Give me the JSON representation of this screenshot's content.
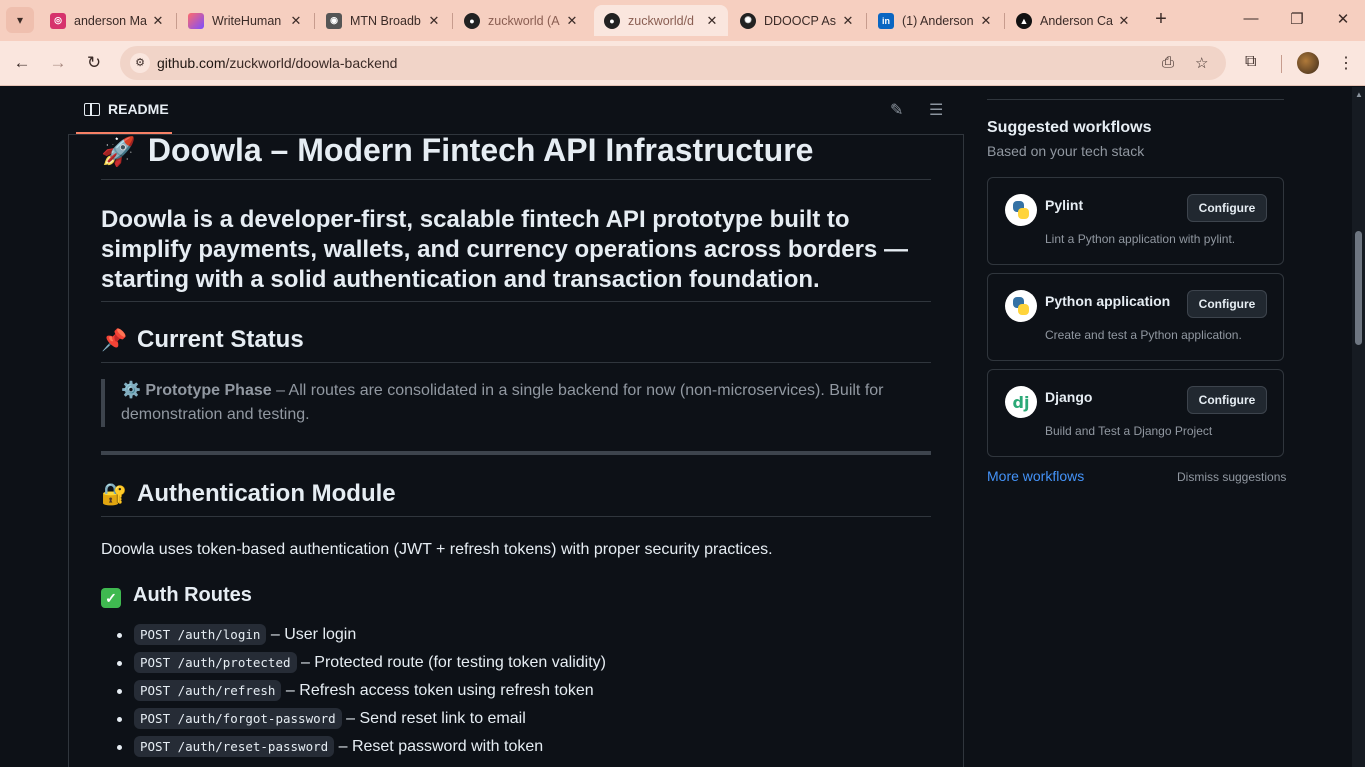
{
  "browser": {
    "tabs": [
      {
        "title": "anderson Ma",
        "icon": "instagram-icon",
        "color": "#d6336c"
      },
      {
        "title": "WriteHuman",
        "icon": "writehuman-icon",
        "color": "#7c4dff"
      },
      {
        "title": "MTN Broadb",
        "icon": "mtn-icon",
        "color": "#555555"
      },
      {
        "title": "zuckworld (A",
        "icon": "github-icon",
        "color": "#222222"
      },
      {
        "title": "zuckworld/d",
        "icon": "github-icon",
        "color": "#222222"
      },
      {
        "title": "DDOOCP As",
        "icon": "chatgpt-icon",
        "color": "#222222"
      },
      {
        "title": "(1) Anderson",
        "icon": "linkedin-icon",
        "color": "#0a66c2"
      },
      {
        "title": "Anderson Ca",
        "icon": "vercel-icon",
        "color": "#111111"
      }
    ],
    "active_tab": 4,
    "url": "github.com/zuckworld/doowla-backend",
    "url_host": "github.com",
    "url_path": "/zuckworld/doowla-backend"
  },
  "readme": {
    "tab_label": "README",
    "title_emoji": "🚀",
    "title": "Doowla – Modern Fintech API Infrastructure",
    "lead": "Doowla is a developer-first, scalable fintech API prototype built to simplify payments, wallets, and currency operations across borders — starting with a solid authentication and transaction foundation.",
    "status_heading": "Current Status",
    "status_emoji": "📌",
    "quote_emoji": "⚙️",
    "quote_bold": "Prototype Phase",
    "quote_text": " – All routes are consolidated in a single backend for now (non-microservices). Built for demonstration and testing.",
    "auth_heading": "Authentication Module",
    "auth_emoji": "🔐",
    "auth_para": "Doowla uses token-based authentication (JWT + refresh tokens) with proper security practices.",
    "routes_heading": "Auth Routes",
    "routes": [
      {
        "code": "POST /auth/login",
        "desc": " – User login"
      },
      {
        "code": "POST /auth/protected",
        "desc": " – Protected route (for testing token validity)"
      },
      {
        "code": "POST /auth/refresh",
        "desc": " – Refresh access token using refresh token"
      },
      {
        "code": "POST /auth/forgot-password",
        "desc": " – Send reset link to email"
      },
      {
        "code": "POST /auth/reset-password",
        "desc": " – Reset password with token"
      }
    ]
  },
  "sidebar": {
    "title": "Suggested workflows",
    "subtitle": "Based on your tech stack",
    "workflows": [
      {
        "name": "Pylint",
        "desc": "Lint a Python application with pylint.",
        "button": "Configure",
        "icon": "python-icon"
      },
      {
        "name": "Python application",
        "desc": "Create and test a Python application.",
        "button": "Configure",
        "icon": "python-icon"
      },
      {
        "name": "Django",
        "desc": "Build and Test a Django Project",
        "button": "Configure",
        "icon": "django-icon",
        "logo_text": "dj"
      }
    ],
    "more_link": "More workflows",
    "dismiss": "Dismiss suggestions"
  },
  "colors": {
    "background": "#0d1117",
    "border": "#30363d",
    "link": "#4493f8",
    "tab_underline": "#f78166",
    "chrome": "#f6cfc0"
  }
}
